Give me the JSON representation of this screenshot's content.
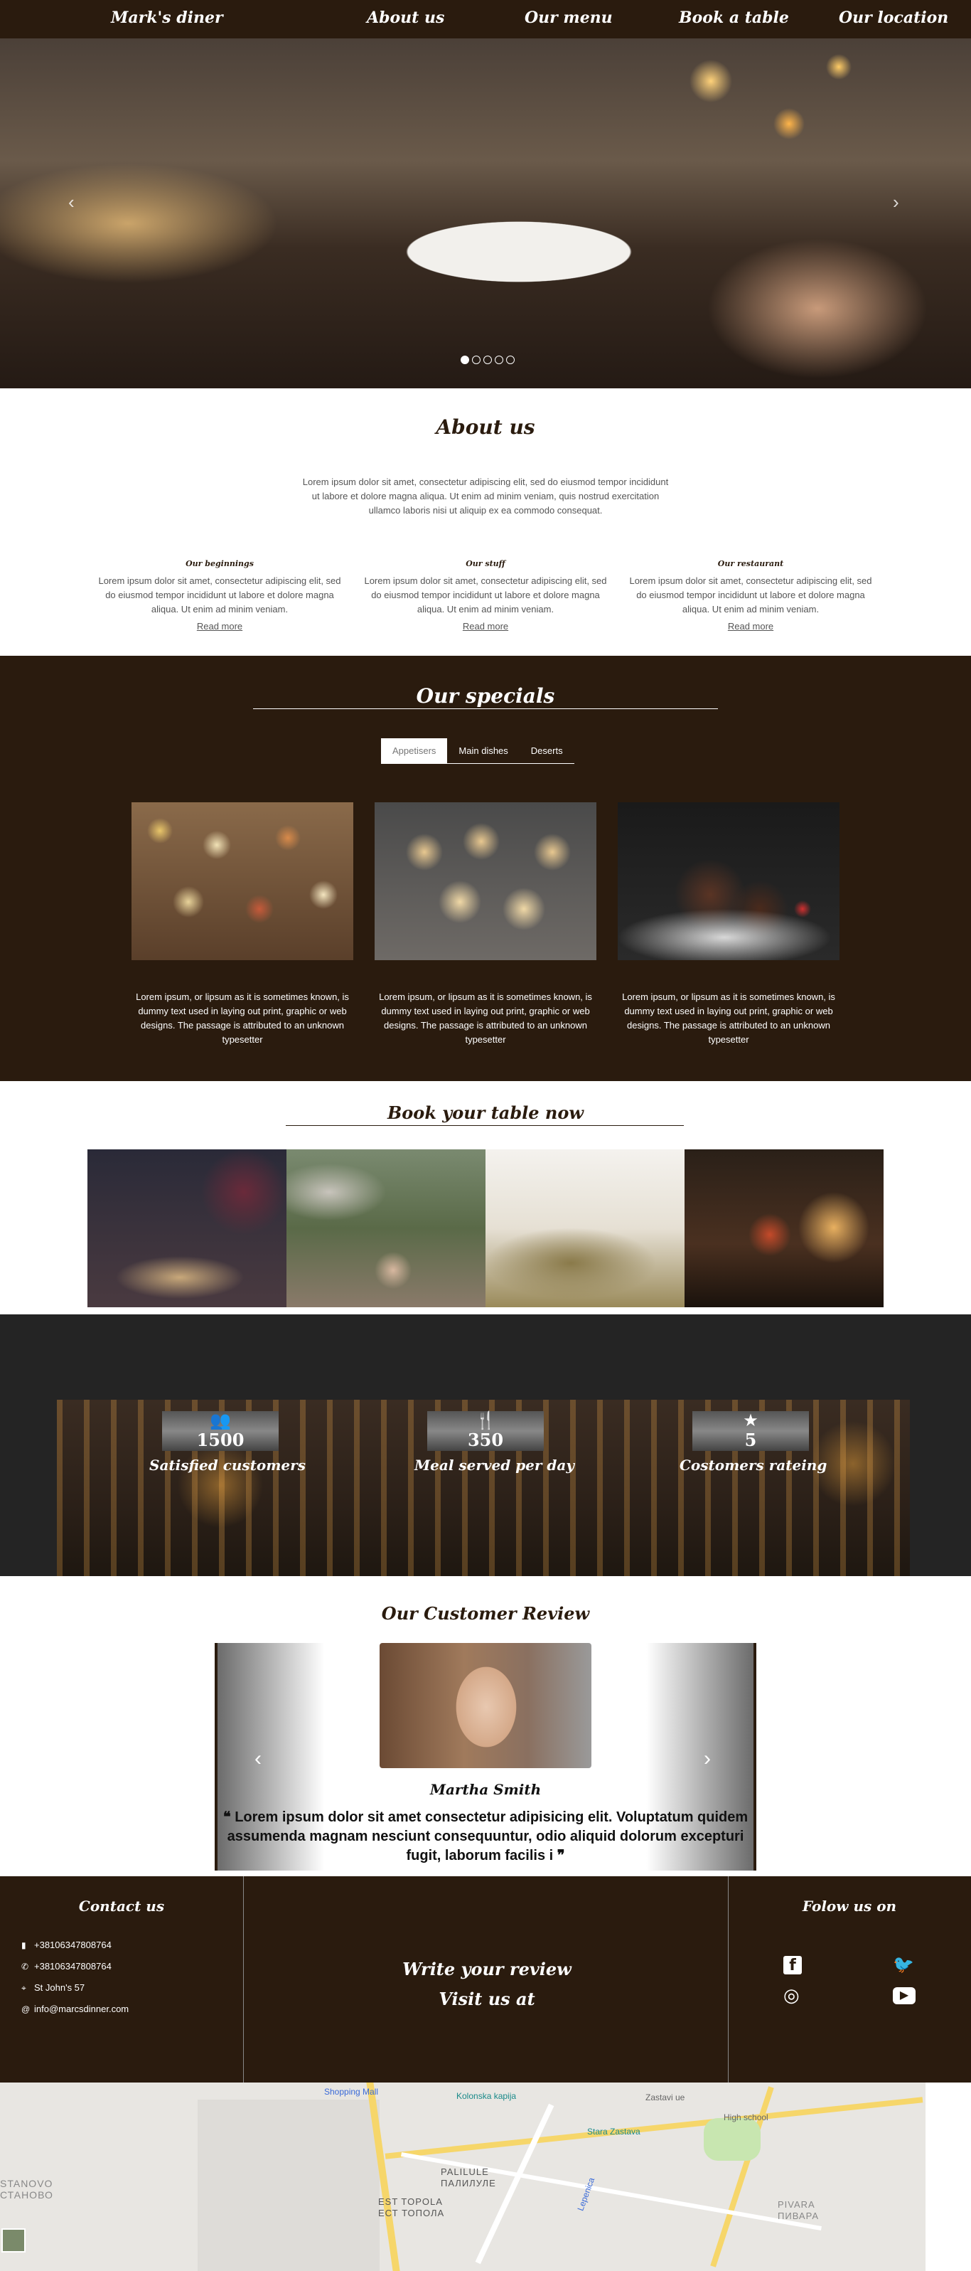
{
  "nav": {
    "brand": "Mark's diner",
    "links": [
      "About us",
      "Our menu",
      "Book a table",
      "Our location"
    ]
  },
  "hero": {
    "prev": "‹",
    "next": "›",
    "slides_total": 5,
    "active_slide": 1
  },
  "about": {
    "title": "About us",
    "text": "Lorem ipsum dolor sit amet, consectetur adipiscing elit, sed do eiusmod tempor incididunt ut labore et dolore magna aliqua. Ut enim ad minim veniam, quis nostrud exercitation ullamco laboris nisi ut aliquip ex ea commodo consequat.",
    "columns": [
      {
        "heading": "Our beginnings",
        "text": "Lorem ipsum dolor sit amet, consectetur adipiscing elit, sed do eiusmod tempor incididunt ut labore et dolore magna aliqua. Ut enim ad minim veniam.",
        "link": "Read more"
      },
      {
        "heading": "Our stuff",
        "text": "Lorem ipsum dolor sit amet, consectetur adipiscing elit, sed do eiusmod tempor incididunt ut labore et dolore magna aliqua. Ut enim ad minim veniam.",
        "link": "Read more"
      },
      {
        "heading": "Our restaurant",
        "text": "Lorem ipsum dolor sit amet, consectetur adipiscing elit, sed do eiusmod tempor incididunt ut labore et dolore magna aliqua. Ut enim ad minim veniam.",
        "link": "Read more"
      }
    ]
  },
  "specials": {
    "title": "Our specials",
    "tabs": [
      "Appetisers",
      "Main dishes",
      "Deserts"
    ],
    "active_tab": "Appetisers",
    "cards": [
      {
        "text": "Lorem ipsum, or lipsum as it is sometimes known, is dummy text used in laying out print, graphic or web designs. The passage is attributed to an unknown typesetter"
      },
      {
        "text": "Lorem ipsum, or lipsum as it is sometimes known, is dummy text used in laying out print, graphic or web designs. The passage is attributed to an unknown typesetter"
      },
      {
        "text": "Lorem ipsum, or lipsum as it is sometimes known, is dummy text used in laying out print, graphic or web designs. The passage is attributed to an unknown typesetter"
      }
    ]
  },
  "book": {
    "title": "Book your table now"
  },
  "stats": [
    {
      "icon": "users-icon",
      "glyph": "👥",
      "value": "1500",
      "label": "Satisfied customers"
    },
    {
      "icon": "utensils-icon",
      "glyph": "🍴",
      "value": "350",
      "label": "Meal served per day"
    },
    {
      "icon": "star-icon",
      "glyph": "★",
      "value": "5",
      "label": "Costomers rateing"
    }
  ],
  "review": {
    "title": "Our Customer Review",
    "name": "Martha Smith",
    "open_quote": "❝",
    "close_quote": "❞",
    "text": "Lorem ipsum dolor sit amet consectetur adipisicing elit. Voluptatum quidem assumenda magnam nesciunt consequuntur, odio aliquid dolorum excepturi fugit, laborum facilis i",
    "prev": "‹",
    "next": "›"
  },
  "footer": {
    "contact_title": "Contact us",
    "contacts": [
      {
        "icon": "mobile-icon",
        "glyph": "▮",
        "text": "+38106347808764"
      },
      {
        "icon": "phone-icon",
        "glyph": "✆",
        "text": "+38106347808764"
      },
      {
        "icon": "map-pin-icon",
        "glyph": "⌖",
        "text": "St John's 57"
      },
      {
        "icon": "at-icon",
        "glyph": "@",
        "text": "info@marcsdinner.com"
      }
    ],
    "cta_line1": "Write your review",
    "cta_line2": "Visit us at",
    "follow_title": "Folow us on",
    "social": [
      {
        "icon": "facebook-icon",
        "glyph": "f"
      },
      {
        "icon": "twitter-icon",
        "glyph": "🐦"
      },
      {
        "icon": "instagram-icon",
        "glyph": "◎"
      },
      {
        "icon": "youtube-icon",
        "glyph": "▶"
      }
    ]
  },
  "map": {
    "labels": [
      "Shopping Mall",
      "Kolonska kapija",
      "Zastavi ue",
      "High school",
      "Stara Zastava",
      "PALILULE",
      "ПАЛИЛУЛЕ",
      "EST TOPOLA",
      "ЕСТ ТОПОЛА",
      "STANOVO",
      "СТАНОВО",
      "PIVARA",
      "ПИВАРА",
      "Lepenica"
    ]
  },
  "colors": {
    "brand": "#2a1b0e",
    "stats_bg": "#242424"
  }
}
